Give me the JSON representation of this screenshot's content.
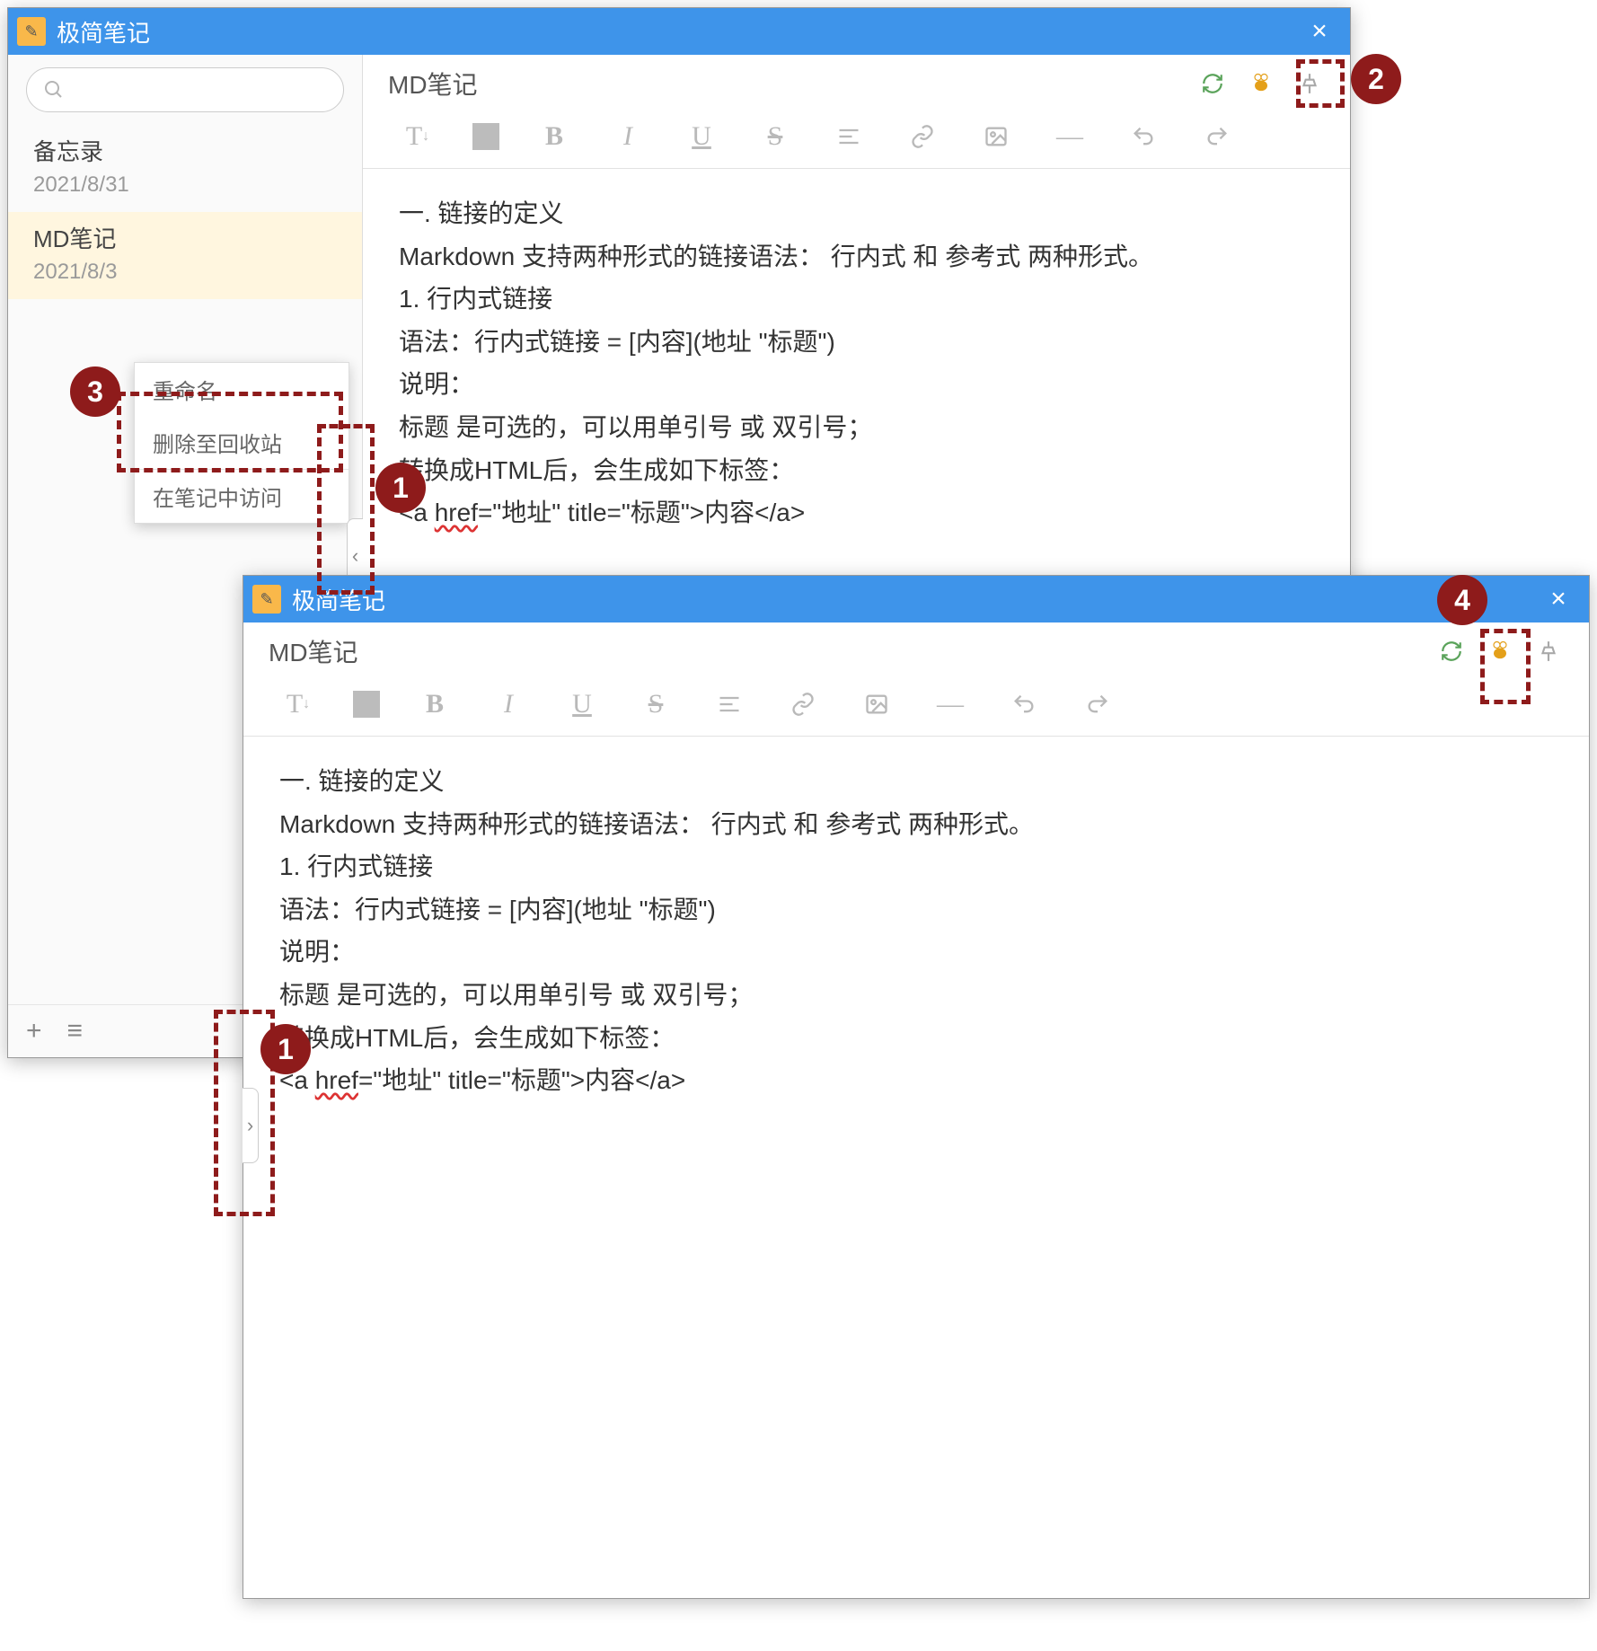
{
  "app_title": "极简笔记",
  "close_glyph": "×",
  "search_placeholder": "",
  "sidebar": {
    "items": [
      {
        "title": "备忘录",
        "date": "2021/8/31"
      },
      {
        "title": "MD笔记",
        "date": "2021/8/3"
      }
    ],
    "add_glyph": "+",
    "list_glyph": "≡"
  },
  "context_menu": {
    "rename": "重命名",
    "delete": "删除至回收站",
    "open": "在笔记中访问"
  },
  "doc": {
    "title": "MD笔记",
    "lines": [
      "一. 链接的定义",
      "Markdown 支持两种形式的链接语法： 行内式 和 参考式 两种形式。",
      "1. 行内式链接",
      "语法：行内式链接 = [内容](地址 \"标题\")",
      "说明：",
      "标题 是可选的，可以用单引号 或 双引号；",
      "转换成HTML后，会生成如下标签："
    ],
    "code_prefix": "<a ",
    "code_err": "href",
    "code_suffix": "=\"地址\" title=\"标题\">内容</a>"
  },
  "collapse_left": "‹",
  "collapse_right": "›",
  "annotations": {
    "b1": "1",
    "b2": "2",
    "b3": "3",
    "b4": "4"
  }
}
